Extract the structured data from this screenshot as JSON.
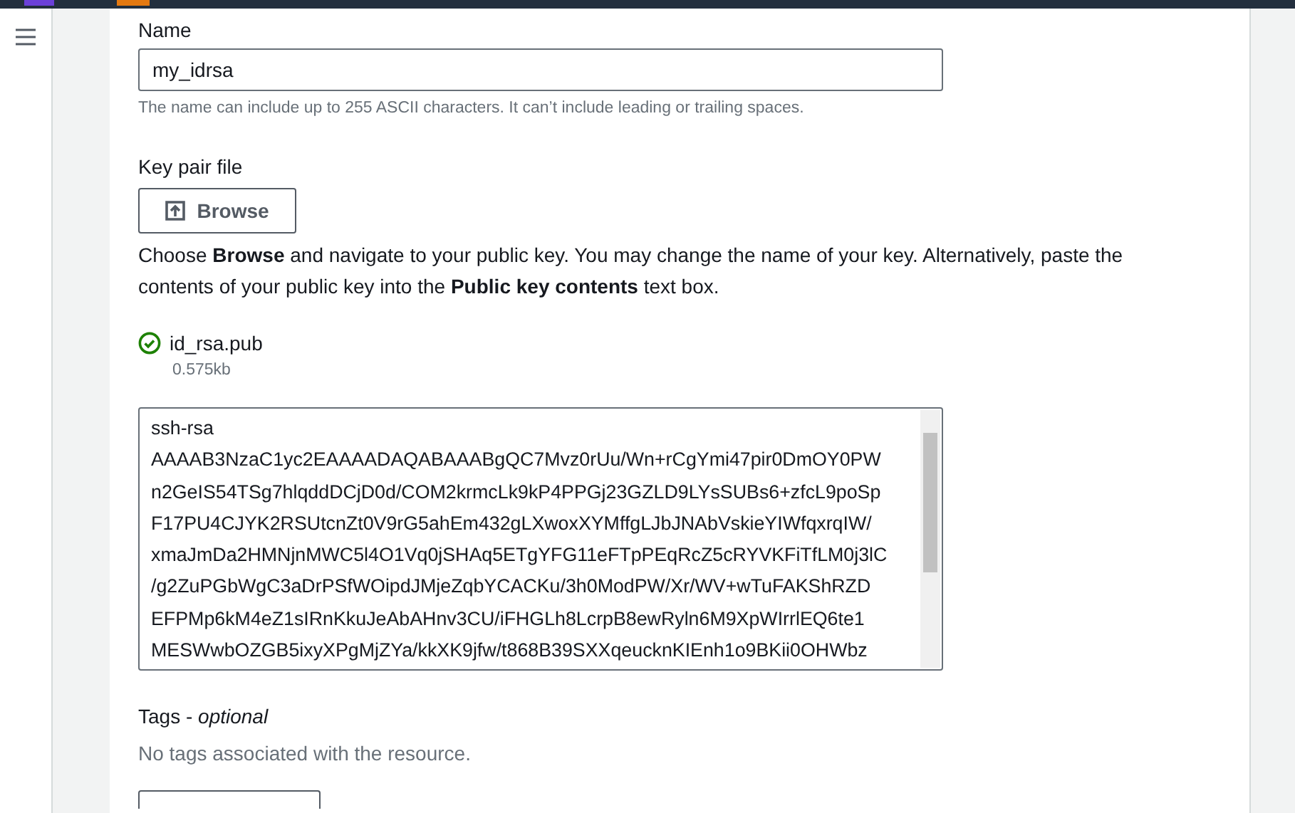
{
  "name_field": {
    "label": "Name",
    "value": "my_idrsa",
    "hint": "The name can include up to 255 ASCII characters. It can’t include leading or trailing spaces."
  },
  "key_file": {
    "label": "Key pair file",
    "browse_button": "Browse",
    "description": "Choose **Browse** and navigate to your public key. You may change the name of your key. Alternatively, paste the contents of your public key into the **Public key contents** text box.",
    "file": {
      "name": "id_rsa.pub",
      "size": "0.575kb",
      "valid": true
    }
  },
  "key_contents": {
    "lines": [
      "ssh-rsa",
      "AAAAB3NzaC1yc2EAAAADAQABAAABgQC7Mvz0rUu/Wn+rCgYmi47pir0DmOY0PW",
      "n2GeIS54TSg7hlqddDCjD0d/COM2krmcLk9kP4PPGj23GZLD9LYsSUBs6+zfcL9poSp",
      "F17PU4CJYK2RSUtcnZt0V9rG5ahEm432gLXwoxXYMffgLJbJNAbVskieYIWfqxrqIW/",
      "xmaJmDa2HMNjnMWC5l4O1Vq0jSHAq5ETgYFG11eFTpPEqRcZ5cRYVKFiTfLM0j3lC",
      "/g2ZuPGbWgC3aDrPSfWOipdJMjeZqbYCACKu/3h0ModPW/Xr/WV+wTuFAKShRZD",
      "EFPMp6kM4eZ1sIRnKkuJeAbAHnv3CU/iFHGLh8LcrpB8ewRyln6M9XpWIrrlEQ6te1",
      "MESWwbOZGB5ixyXPgMjZYa/kkXK9jfw/t868B39SXXqeucknKIEnh1o9BKii0OHWbz"
    ]
  },
  "tags": {
    "label": "Tags",
    "separator": "-",
    "optional": "optional",
    "empty_text": "No tags associated with the resource."
  }
}
